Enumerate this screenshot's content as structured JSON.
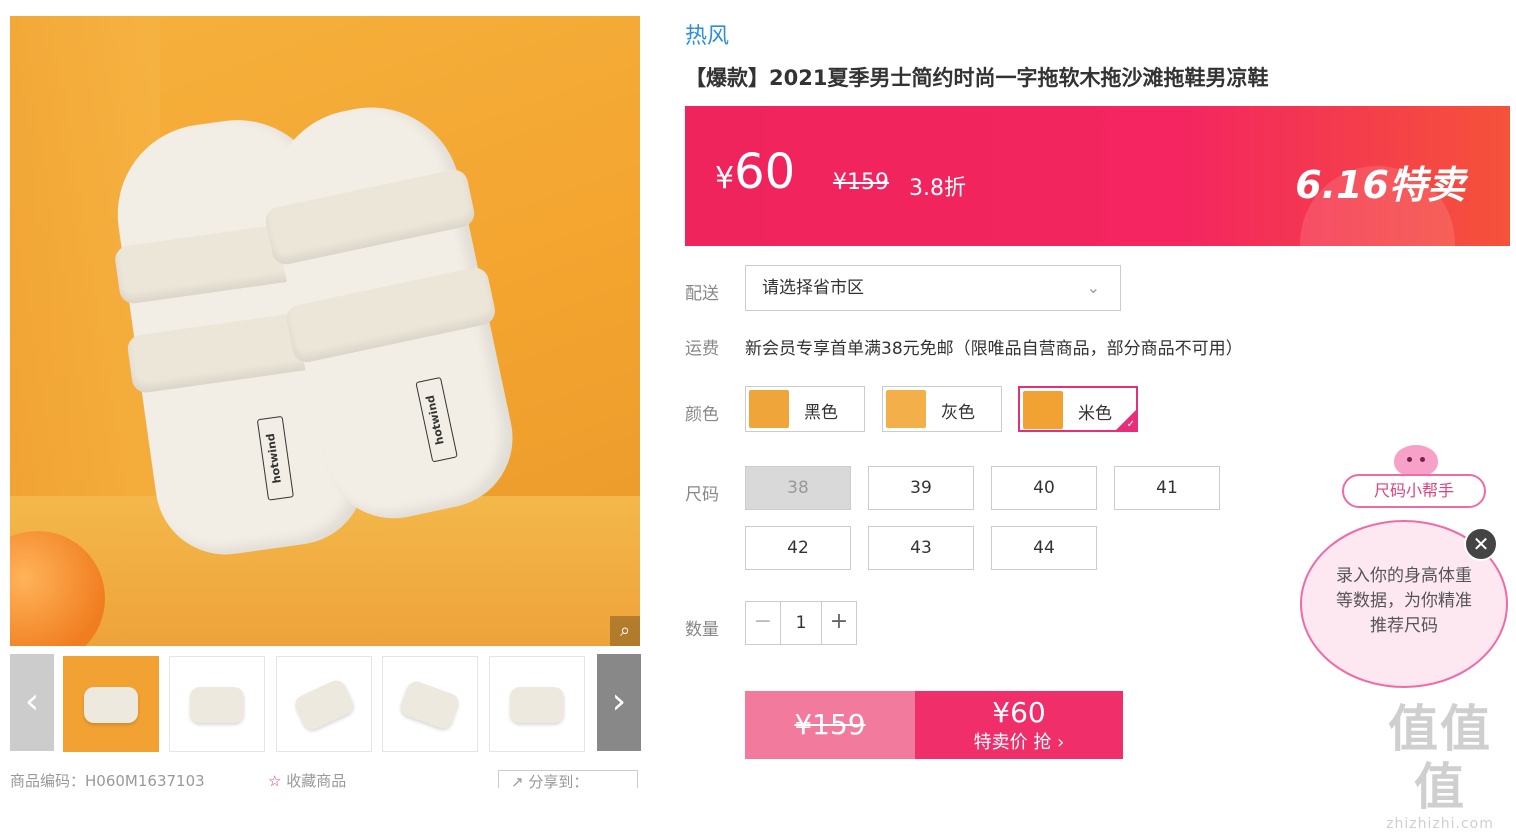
{
  "gallery": {
    "zoom_icon": "magnifier-icon",
    "prev_icon": "chevron-left-icon",
    "next_icon": "chevron-right-icon",
    "tag_text": "hotwind",
    "product_code_label": "商品编码：H060M1637103",
    "favorite_label": "收藏商品",
    "share_label": "分享到："
  },
  "product": {
    "brand": "热风",
    "title": "【爆款】2021夏季男士简约时尚一字拖软木拖沙滩拖鞋男凉鞋"
  },
  "price": {
    "currency": "¥",
    "now": "60",
    "original": "¥159",
    "discount": "3.8折",
    "event": "6.16特卖"
  },
  "delivery": {
    "label": "配送",
    "placeholder": "请选择省市区"
  },
  "shipping": {
    "label": "运费",
    "text": "新会员专享首单满38元免邮（限唯品自营商品，部分商品不可用）"
  },
  "colors": {
    "label": "颜色",
    "options": [
      {
        "name": "黑色",
        "swatch": "#f0a53a"
      },
      {
        "name": "灰色",
        "swatch": "#f3b04a"
      },
      {
        "name": "米色",
        "swatch": "#f2a232"
      }
    ],
    "selected": "米色"
  },
  "sizes": {
    "label": "尺码",
    "options": [
      "38",
      "39",
      "40",
      "41",
      "42",
      "43",
      "44"
    ],
    "unavailable": [
      "38"
    ]
  },
  "quantity": {
    "label": "数量",
    "value": "1",
    "minus": "−",
    "plus": "+"
  },
  "buy": {
    "original": "¥159",
    "price": "¥60",
    "action": "特卖价 抢 ›"
  },
  "size_helper": {
    "title": "尺码小帮手",
    "bubble_text": "录入你的身高体重等数据，为你精准推荐尺码",
    "close": "✕"
  },
  "watermark": {
    "big": "值值值",
    "small": "zhizhizhi.com"
  },
  "colors_theme": {
    "accent": "#f0245c",
    "link": "#2a8ed8",
    "pink_border": "#ef6aa7"
  }
}
